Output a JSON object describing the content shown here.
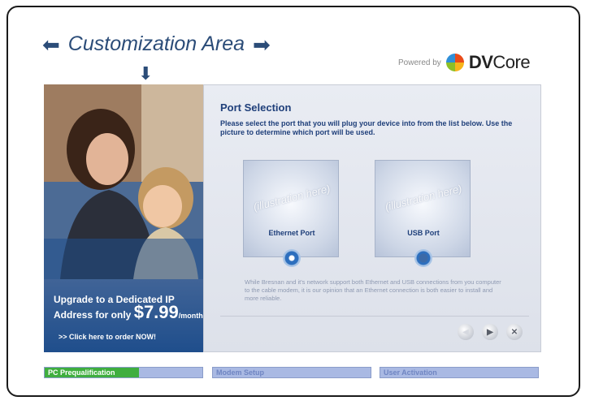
{
  "header": {
    "title": "Customization Area",
    "powered_by": "Powered by",
    "brand_bold": "DV",
    "brand_light": "Core"
  },
  "ad": {
    "line1": "Upgrade to a Dedicated IP",
    "line2": "Address for only",
    "price": "$7.99",
    "per": "/month",
    "cta": ">> Click here to order NOW!"
  },
  "port_selection": {
    "title": "Port Selection",
    "instructions": "Please select the port that you will plug your device into from the list below. Use the picture to determine which port will be used.",
    "ports": [
      {
        "illustration": "(illustration here)",
        "label": "Ethernet Port",
        "selected": true
      },
      {
        "illustration": "(illustration here)",
        "label": "USB Port",
        "selected": false
      }
    ],
    "info": "While Bresnan and it's network support both Ethernet and USB connections from you computer to the cable modem, it is our opinion that an Ethernet connection is both easier to install and more reliable."
  },
  "nav": {
    "back_icon": "◀",
    "next_icon": "▶",
    "cancel_icon": "✕"
  },
  "steps": [
    {
      "label": "PC Prequalification",
      "progress": 0.6,
      "active": true
    },
    {
      "label": "Modem Setup",
      "progress": 0,
      "active": false
    },
    {
      "label": "User Activation",
      "progress": 0,
      "active": false
    }
  ],
  "colors": {
    "accent": "#2b4c78",
    "progress": "#3fae3f",
    "step_bg": "#a9b9e3"
  }
}
